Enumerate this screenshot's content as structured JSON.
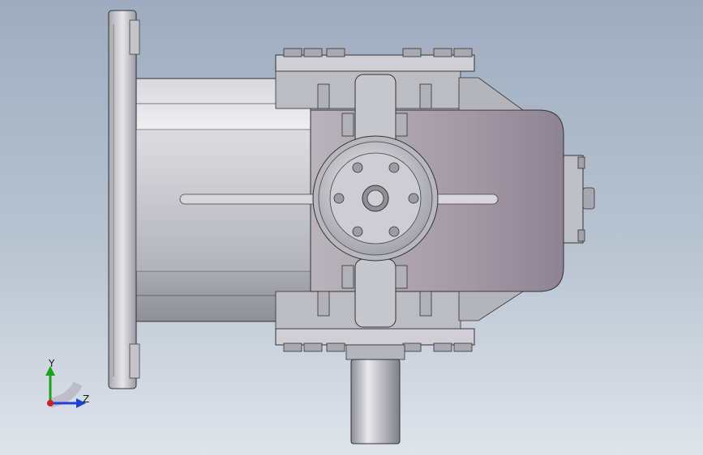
{
  "view": {
    "background_top": "#9eacbf",
    "background_bottom": "#dfe4ea",
    "model_color": "#c8c8cf",
    "housing_tint": "#9d939f"
  },
  "triad": {
    "y_label": "Y",
    "z_label": "Z",
    "y_color": "#1aa31a",
    "z_color": "#1f3fd6",
    "x_color": "#d11f1f"
  }
}
